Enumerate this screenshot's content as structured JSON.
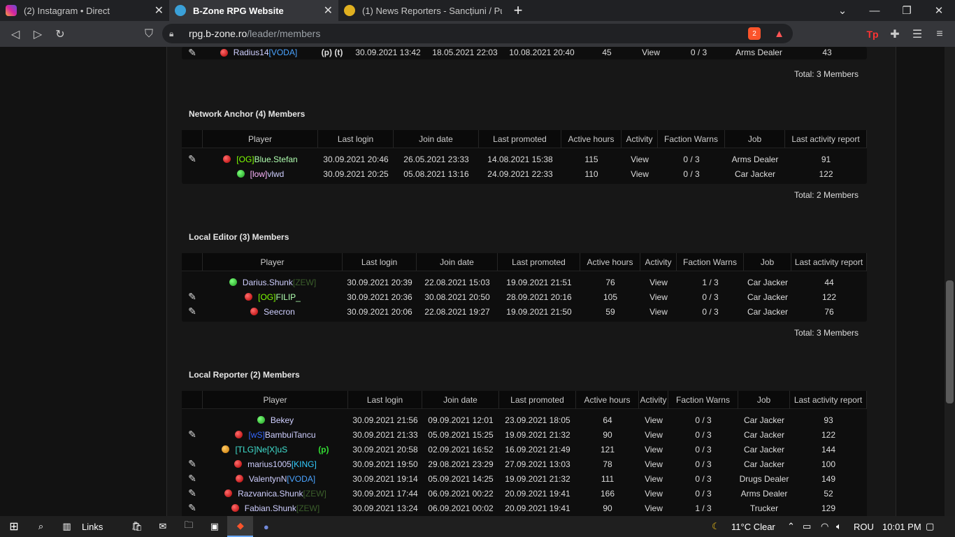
{
  "browser": {
    "tabs": [
      {
        "title": "(2) Instagram • Direct",
        "icon": "instagram-icon",
        "color": "#d6249f"
      },
      {
        "title": "B-Zone RPG Website",
        "icon": "bzone-icon",
        "color": "#3aa0d8"
      },
      {
        "title": "(1) News Reporters - Sancțiuni / Punish",
        "icon": "forum-icon",
        "color": "#e0b020"
      }
    ],
    "url_host": "rpg.b-zone.ro",
    "url_path": "/leader/members",
    "shield_count": "2"
  },
  "top_fragment": {
    "player": "Radius14",
    "tag": "[VODA]",
    "flags": "(p) (t)",
    "last_login": "30.09.2021 13:42",
    "join_date": "18.05.2021 22:03",
    "last_promoted": "10.08.2021 20:40",
    "hours": "45",
    "activity": "View",
    "warns": "0 / 3",
    "job": "Arms Dealer",
    "report": "43",
    "total": "Total: 3 Members"
  },
  "headers": [
    "Player",
    "Last login",
    "Join date",
    "Last promoted",
    "Active hours",
    "Activity",
    "Faction Warns",
    "Job",
    "Last activity report"
  ],
  "sections": [
    {
      "title": "Network Anchor (4) Members",
      "total": "Total: 2 Members",
      "rows": [
        {
          "edit": true,
          "status": "red",
          "prefix": "[OG]",
          "name": "Blue.Stefan",
          "suffix": "",
          "flags": "",
          "last_login": "30.09.2021 20:46",
          "join": "26.05.2021 23:33",
          "promoted": "14.08.2021 15:38",
          "hours": "115",
          "activity": "View",
          "warns": "0 / 3",
          "job": "Arms Dealer",
          "report": "91"
        },
        {
          "edit": false,
          "status": "green",
          "prefix": "[low]",
          "name": "vlwd",
          "suffix": "",
          "flags": "",
          "last_login": "30.09.2021 20:25",
          "join": "05.08.2021 13:16",
          "promoted": "24.09.2021 22:33",
          "hours": "110",
          "activity": "View",
          "warns": "0 / 3",
          "job": "Car Jacker",
          "report": "122"
        }
      ]
    },
    {
      "title": "Local Editor (3) Members",
      "total": "Total: 3 Members",
      "rows": [
        {
          "edit": false,
          "status": "green",
          "prefix": "",
          "name": "Darius.Shunk",
          "suffix": "[ZEW]",
          "flags": "",
          "last_login": "30.09.2021 20:39",
          "join": "22.08.2021 15:03",
          "promoted": "19.09.2021 21:51",
          "hours": "76",
          "activity": "View",
          "warns": "1 / 3",
          "job": "Car Jacker",
          "report": "44"
        },
        {
          "edit": true,
          "status": "red",
          "prefix": "[OG]",
          "name": "FILIP_",
          "suffix": "",
          "flags": "",
          "last_login": "30.09.2021 20:36",
          "join": "30.08.2021 20:50",
          "promoted": "28.09.2021 20:16",
          "hours": "105",
          "activity": "View",
          "warns": "0 / 3",
          "job": "Car Jacker",
          "report": "122"
        },
        {
          "edit": true,
          "status": "red",
          "prefix": "",
          "name": "Seecron",
          "suffix": "",
          "flags": "",
          "last_login": "30.09.2021 20:06",
          "join": "22.08.2021 19:27",
          "promoted": "19.09.2021 21:50",
          "hours": "59",
          "activity": "View",
          "warns": "0 / 3",
          "job": "Car Jacker",
          "report": "76"
        }
      ]
    },
    {
      "title": "Local Reporter (2) Members",
      "total": "",
      "rows": [
        {
          "edit": false,
          "status": "green",
          "prefix": "",
          "name": "Bekey",
          "suffix": "",
          "flags": "",
          "last_login": "30.09.2021 21:56",
          "join": "09.09.2021 12:01",
          "promoted": "23.09.2021 18:05",
          "hours": "64",
          "activity": "View",
          "warns": "0 / 3",
          "job": "Car Jacker",
          "report": "93"
        },
        {
          "edit": true,
          "status": "red",
          "prefix": "[wS]",
          "name": "BambuiTancu",
          "suffix": "",
          "flags": "",
          "last_login": "30.09.2021 21:33",
          "join": "05.09.2021 15:25",
          "promoted": "19.09.2021 21:32",
          "hours": "90",
          "activity": "View",
          "warns": "0 / 3",
          "job": "Car Jacker",
          "report": "122"
        },
        {
          "edit": false,
          "status": "orange",
          "prefix": "[TLG]",
          "name": "Ne[X]uS",
          "suffix": "",
          "flags": "(p)",
          "last_login": "30.09.2021 20:58",
          "join": "02.09.2021 16:52",
          "promoted": "16.09.2021 21:49",
          "hours": "121",
          "activity": "View",
          "warns": "0 / 3",
          "job": "Car Jacker",
          "report": "144"
        },
        {
          "edit": true,
          "status": "red",
          "prefix": "",
          "name": "marius1005",
          "suffix": "[KING]",
          "flags": "",
          "last_login": "30.09.2021 19:50",
          "join": "29.08.2021 23:29",
          "promoted": "27.09.2021 13:03",
          "hours": "78",
          "activity": "View",
          "warns": "0 / 3",
          "job": "Car Jacker",
          "report": "100"
        },
        {
          "edit": true,
          "status": "red",
          "prefix": "",
          "name": "ValentynN",
          "suffix": "[VODA]",
          "flags": "",
          "last_login": "30.09.2021 19:14",
          "join": "05.09.2021 14:25",
          "promoted": "19.09.2021 21:32",
          "hours": "111",
          "activity": "View",
          "warns": "0 / 3",
          "job": "Drugs Dealer",
          "report": "149"
        },
        {
          "edit": true,
          "status": "red",
          "prefix": "",
          "name": "Razvanica.Shunk",
          "suffix": "[ZEW]",
          "flags": "",
          "last_login": "30.09.2021 17:44",
          "join": "06.09.2021 00:22",
          "promoted": "20.09.2021 19:41",
          "hours": "166",
          "activity": "View",
          "warns": "0 / 3",
          "job": "Arms Dealer",
          "report": "52"
        },
        {
          "edit": true,
          "status": "red",
          "prefix": "",
          "name": "Fabian.Shunk",
          "suffix": "[ZEW]",
          "flags": "",
          "last_login": "30.09.2021 13:24",
          "join": "06.09.2021 00:02",
          "promoted": "20.09.2021 19:41",
          "hours": "90",
          "activity": "View",
          "warns": "1 / 3",
          "job": "Trucker",
          "report": "129"
        }
      ]
    }
  ],
  "taskbar": {
    "links": "Links",
    "weather": "11°C  Clear",
    "lang": "ROU",
    "time": "10:01 PM"
  }
}
